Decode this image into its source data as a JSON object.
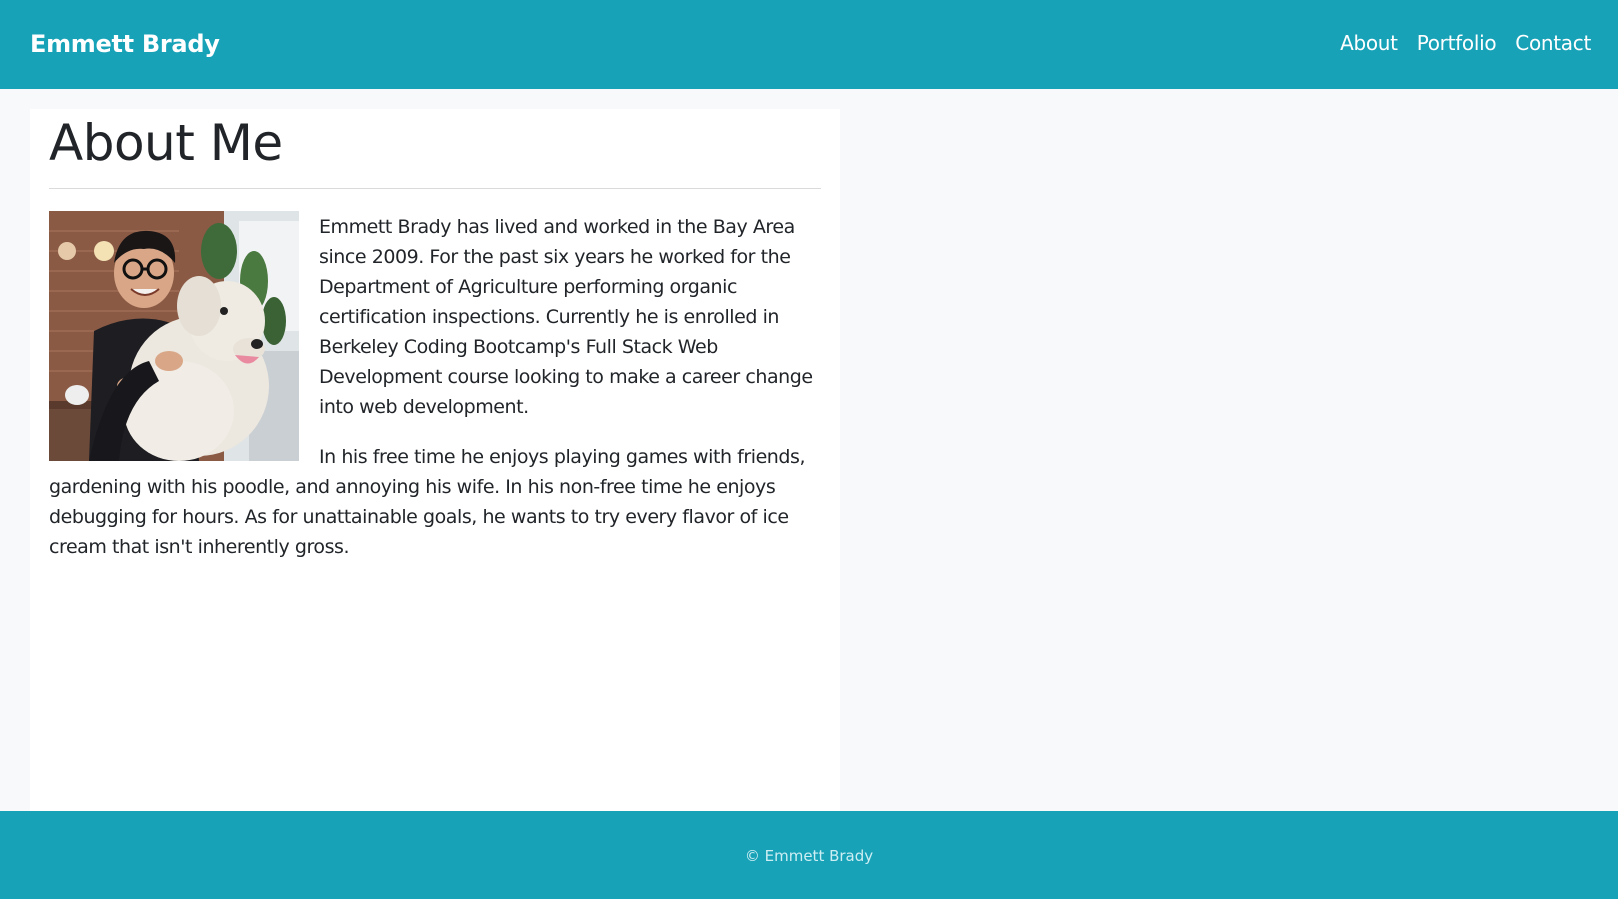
{
  "navbar": {
    "brand": "Emmett Brady",
    "links": [
      {
        "label": "About"
      },
      {
        "label": "Portfolio"
      },
      {
        "label": "Contact"
      }
    ]
  },
  "about": {
    "title": "About Me",
    "photo_alt": "Emmett Brady holding a white poodle",
    "paragraphs": [
      "Emmett Brady has lived and worked in the Bay Area since 2009. For the past six years he worked for the Department of Agriculture performing organic certification inspections. Currently he is enrolled in Berkeley Coding Bootcamp's Full Stack Web Development course looking to make a career change into web development.",
      "In his free time he enjoys playing games with friends, gardening with his poodle, and annoying his wife. In his non-free time he enjoys debugging for hours. As for unattainable goals, he wants to try every flavor of ice cream that isn't inherently gross."
    ]
  },
  "footer": {
    "text": "© Emmett Brady"
  },
  "colors": {
    "primary": "#17a2b8",
    "page_background": "#f8f9fa",
    "card_background": "#ffffff",
    "text": "#212529"
  }
}
